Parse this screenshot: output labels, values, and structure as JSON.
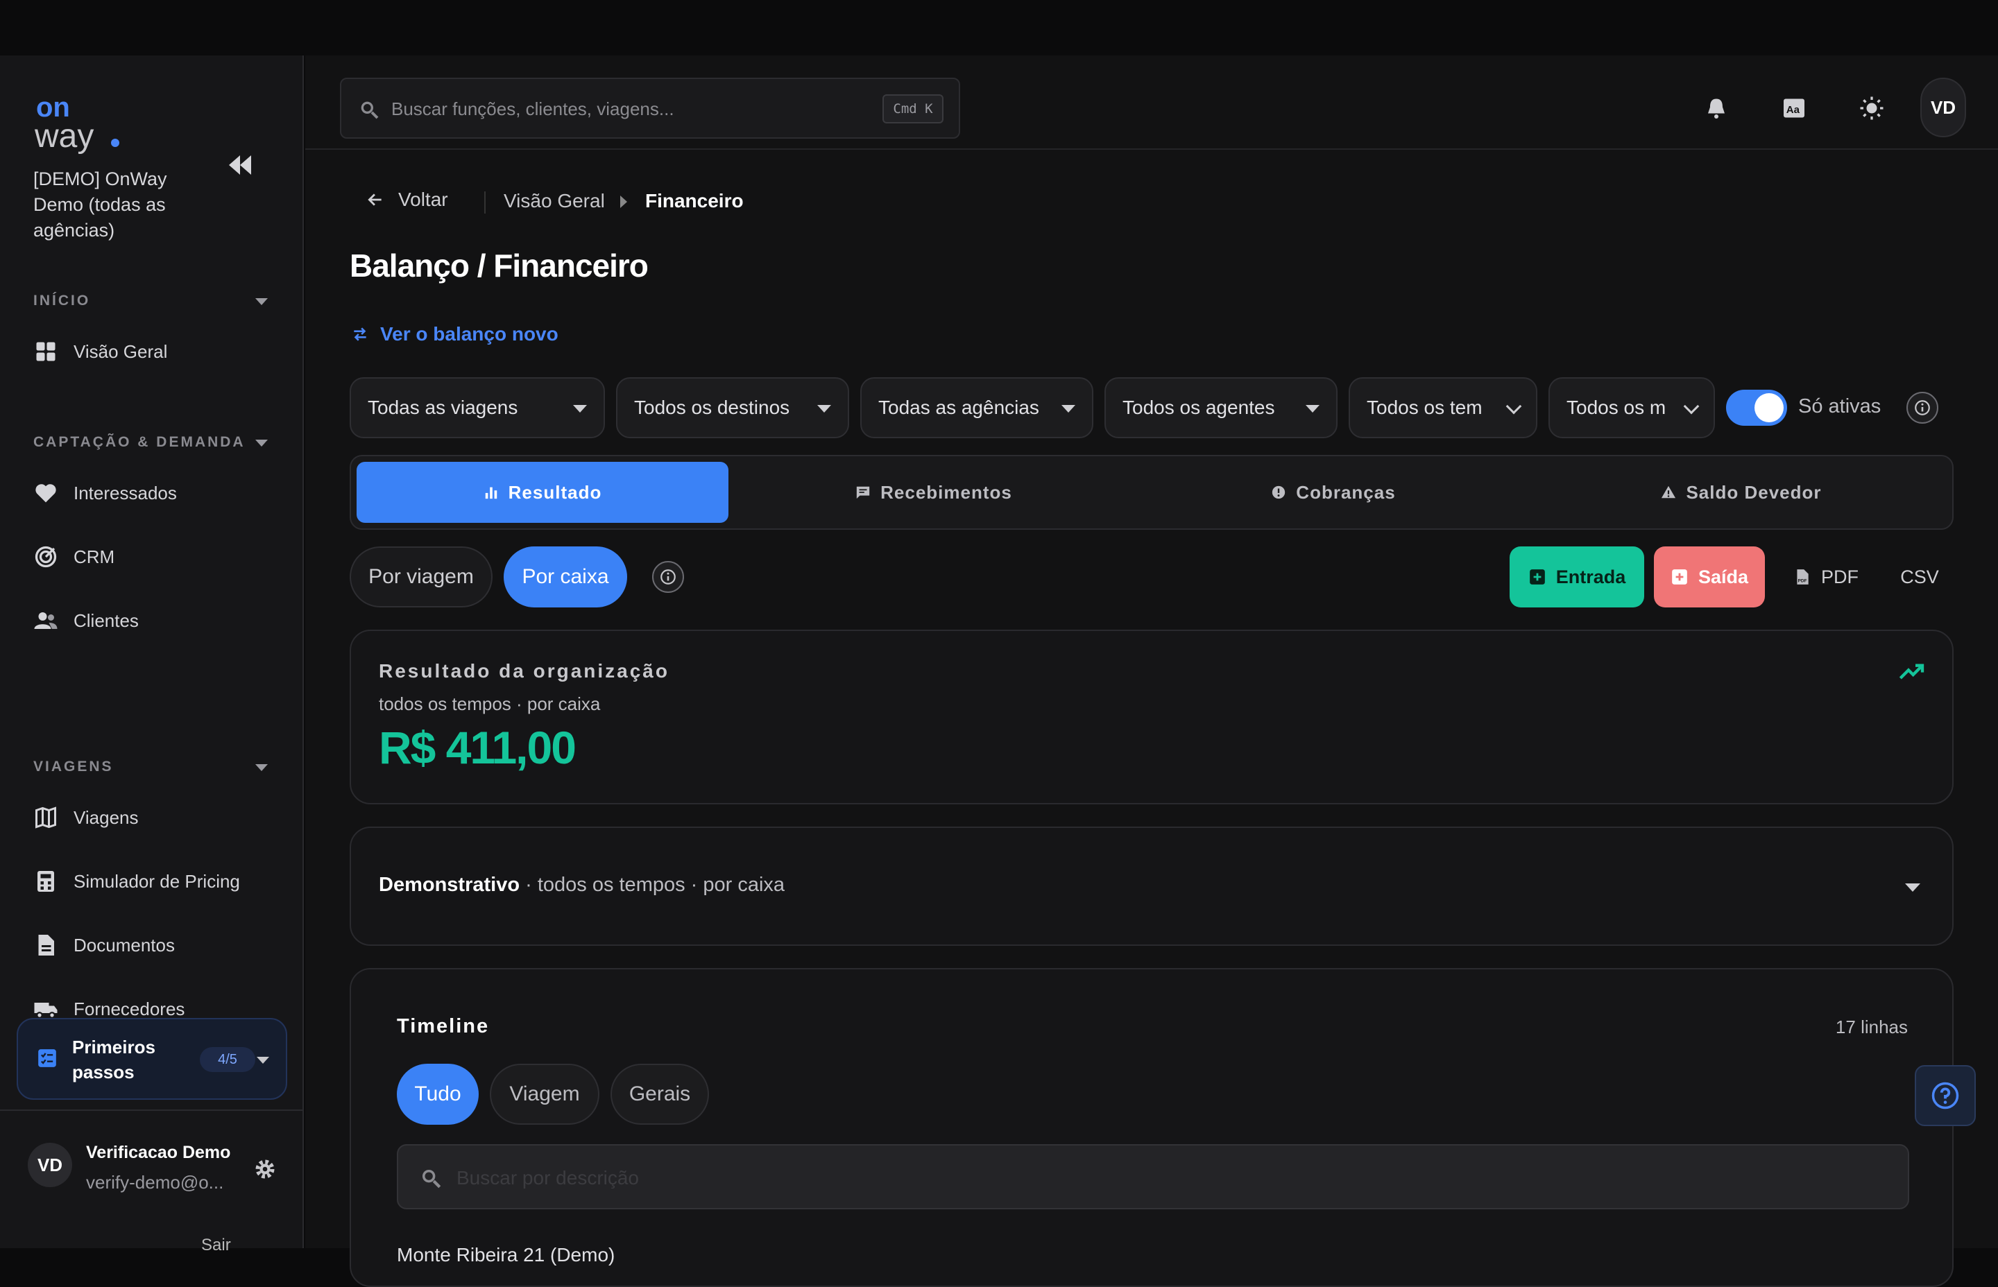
{
  "app": {
    "brand": "onway"
  },
  "sidebar": {
    "org_name": "[DEMO] OnWay Demo (todas as agências)",
    "sections": [
      {
        "label": "INÍCIO",
        "items": [
          {
            "label": "Visão Geral",
            "icon": "grid-icon"
          }
        ]
      },
      {
        "label": "CAPTAÇÃO & DEMANDA",
        "items": [
          {
            "label": "Interessados",
            "icon": "heart-icon"
          },
          {
            "label": "CRM",
            "icon": "target-icon"
          },
          {
            "label": "Clientes",
            "icon": "users-icon"
          }
        ]
      },
      {
        "label": "VIAGENS",
        "items": [
          {
            "label": "Viagens",
            "icon": "map-icon"
          },
          {
            "label": "Simulador de Pricing",
            "icon": "calculator-icon"
          },
          {
            "label": "Documentos",
            "icon": "document-icon"
          },
          {
            "label": "Fornecedores",
            "icon": "truck-icon"
          }
        ]
      }
    ],
    "first_steps": {
      "label": "Primeiros passos",
      "progress": "4/5"
    },
    "user": {
      "initials": "VD",
      "name": "Verificacao Demo",
      "email": "verify-demo@o...",
      "logout": "Sair"
    }
  },
  "header": {
    "search_placeholder": "Buscar funções, clientes, viagens...",
    "shortcut": "Cmd K",
    "avatar_initials": "VD"
  },
  "breadcrumb": {
    "back": "Voltar",
    "items": [
      "Visão Geral",
      "Financeiro"
    ]
  },
  "page": {
    "title": "Balanço / Financeiro",
    "new_link": "Ver o balanço novo"
  },
  "filters": {
    "dropdowns": [
      "Todas as viagens",
      "Todos os destinos",
      "Todas as agências",
      "Todos os agentes",
      "Todos os tem",
      "Todos os m"
    ],
    "active_only_label": "Só ativas",
    "active_only": true
  },
  "tabs": [
    {
      "label": "Resultado",
      "icon": "bar-chart-icon",
      "active": true
    },
    {
      "label": "Recebimentos",
      "icon": "message-icon",
      "active": false
    },
    {
      "label": "Cobranças",
      "icon": "alert-circle-icon",
      "active": false
    },
    {
      "label": "Saldo Devedor",
      "icon": "warning-icon",
      "active": false
    }
  ],
  "mode": {
    "by_trip": "Por viagem",
    "by_cash": "Por caixa",
    "selected": "Por caixa"
  },
  "actions": {
    "entry": "Entrada",
    "exit": "Saída",
    "pdf": "PDF",
    "csv": "CSV"
  },
  "result": {
    "title": "Resultado da organização",
    "subtitle": "todos os tempos · por caixa",
    "value": "R$ 411,00"
  },
  "statement": {
    "title": "Demonstrativo",
    "subtitle": " · todos os tempos · por caixa"
  },
  "timeline": {
    "title": "Timeline",
    "count": "17 linhas",
    "filters": [
      "Tudo",
      "Viagem",
      "Gerais"
    ],
    "search_placeholder": "Buscar por descrição",
    "first_row": "Monte Ribeira 21 (Demo)"
  },
  "colors": {
    "accent": "#3b82f6",
    "success": "#14c49a",
    "danger": "#f07576"
  }
}
